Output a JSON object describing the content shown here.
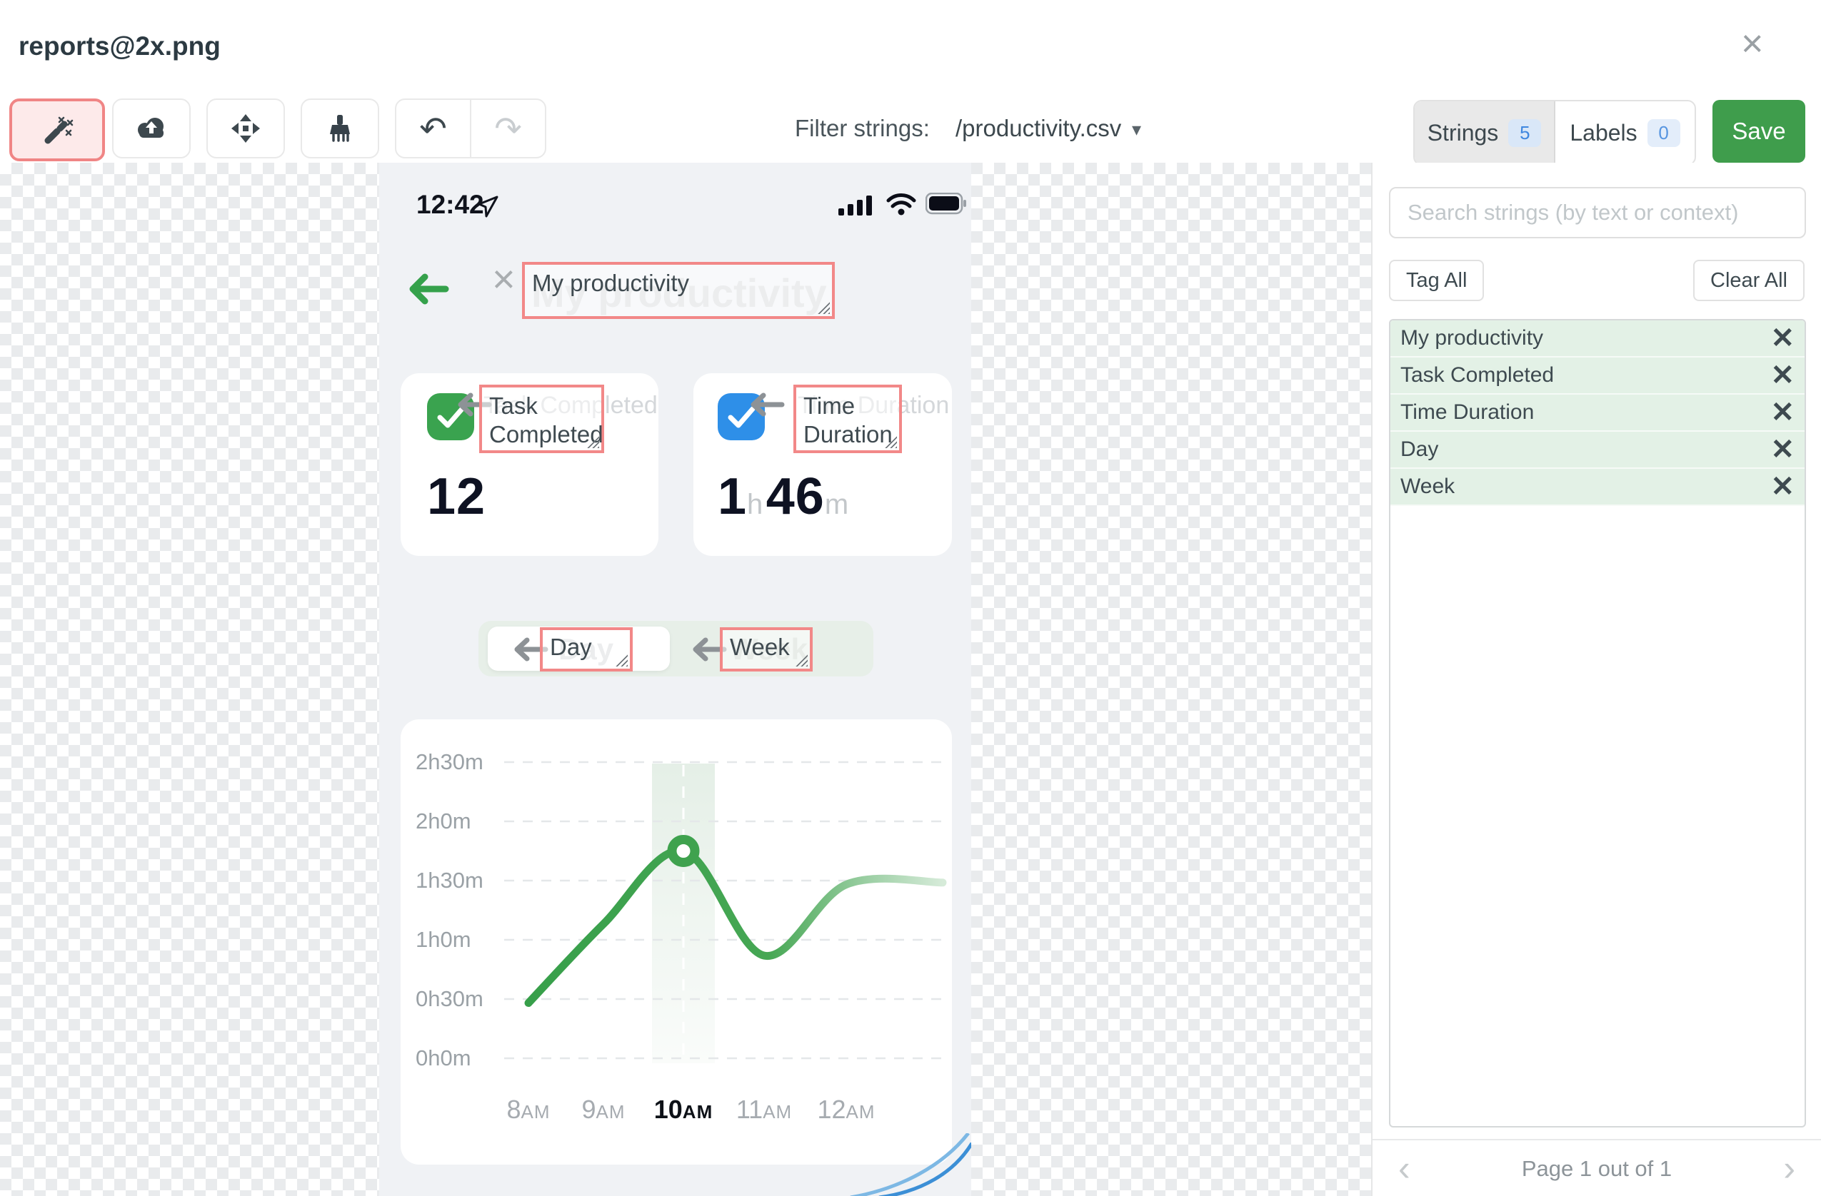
{
  "window": {
    "title": "reports@2x.png"
  },
  "toolbar": {
    "filter_label": "Filter strings:",
    "filter_value": "/productivity.csv",
    "tabs": {
      "strings_label": "Strings",
      "strings_count": "5",
      "labels_label": "Labels",
      "labels_count": "0"
    },
    "save_label": "Save"
  },
  "sidebar": {
    "search_placeholder": "Search strings (by text or context)",
    "tag_all_label": "Tag All",
    "clear_all_label": "Clear All",
    "strings": [
      "My productivity",
      "Task Completed",
      "Time Duration",
      "Day",
      "Week"
    ],
    "pagination": "Page 1 out of 1"
  },
  "phone": {
    "status_time": "12:42",
    "title": "My productivity",
    "close_ghost": "×",
    "cards": [
      {
        "label": "Task Completed",
        "value": "12"
      },
      {
        "label": "Time Duration",
        "value_h": "1",
        "unit_h": "h",
        "value_m": "46",
        "unit_m": "m"
      }
    ],
    "toggle": {
      "left": "Day",
      "right": "Week"
    }
  },
  "icons": {
    "close": "×",
    "caret_down": "▾",
    "undo": "↶",
    "redo": "↷",
    "row_remove": "✕",
    "chev_left": "‹",
    "chev_right": "›"
  },
  "colors": {
    "accent_green": "#3f9d4c",
    "annotation_red": "#f28888",
    "badge_blue": "#3f87df",
    "list_green": "#e3f1e6",
    "line_green": "#3fa24e",
    "card_icon_green": "#3aa34f",
    "card_icon_blue": "#2e8fe8"
  },
  "chart_data": {
    "type": "line",
    "title": "",
    "x": [
      "8AM",
      "9AM",
      "10AM",
      "11AM",
      "12AM"
    ],
    "series": [
      {
        "name": "Time Duration",
        "values_minutes": [
          28,
          68,
          105,
          52,
          88
        ]
      }
    ],
    "y_ticks": [
      "0h0m",
      "0h30m",
      "1h0m",
      "1h30m",
      "2h0m",
      "2h30m"
    ],
    "ylim_minutes": [
      0,
      150
    ],
    "grid": "dashed-horizontal",
    "highlight_x": "10AM",
    "marker": {
      "x": "10AM",
      "value_minutes": 105
    },
    "legend": "none"
  }
}
